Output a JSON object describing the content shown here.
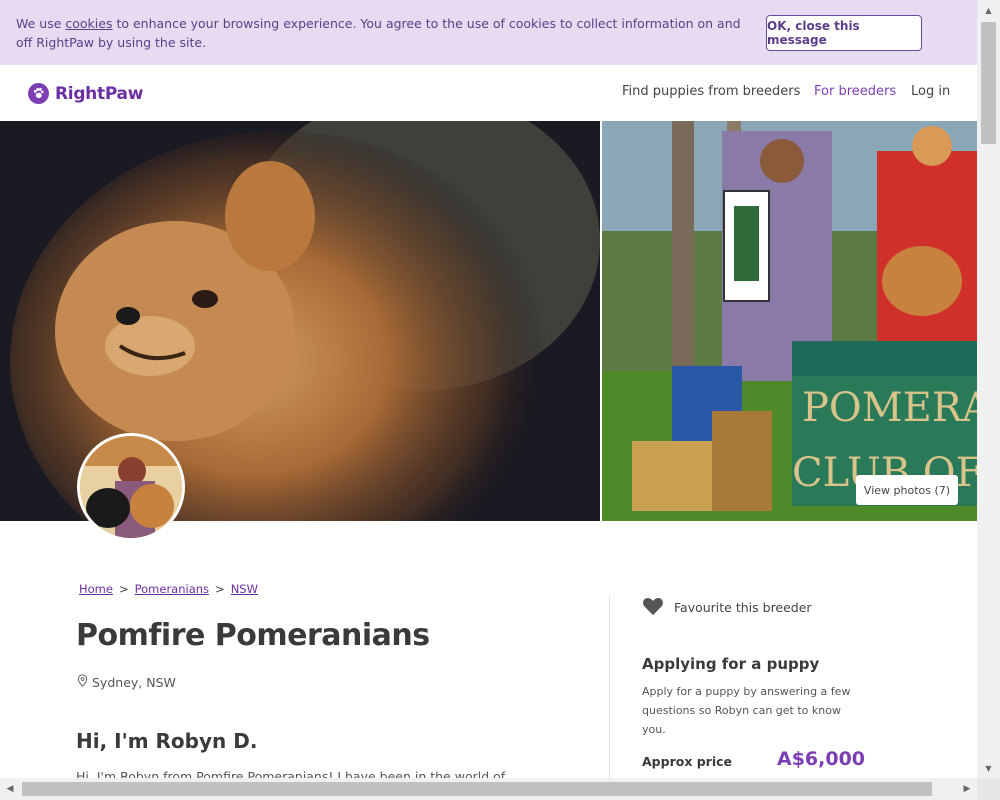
{
  "cookie_banner": {
    "text_before": "We use ",
    "link": "cookies",
    "text_after": " to enhance your browsing experience. You agree to the use of cookies to collect information on and off RightPaw by using the site.",
    "button": "OK, close this message",
    "bg_color": "#e6dbf0"
  },
  "header": {
    "logo": "RightPaw",
    "logo_icon": "paw-icon",
    "nav": {
      "find": "Find puppies from breeders",
      "breeders": "For breeders",
      "login": "Log in"
    },
    "brand_color": "#7b3fb3"
  },
  "hero": {
    "view_photos": "View photos (7)"
  },
  "breadcrumb": {
    "items": [
      "Home",
      "Pomeranians",
      "NSW"
    ],
    "separator": ">"
  },
  "breeder": {
    "name": "Pomfire Pomeranians",
    "location": "Sydney, NSW",
    "greeting": "Hi, I'm Robyn D.",
    "bio": "Hi, I'm Robyn from Pomfire Pomeranians! I have been in the world of"
  },
  "sidebar": {
    "favourite": "Favourite this breeder",
    "apply_title": "Applying for a puppy",
    "apply_desc": "Apply for a puppy by answering a few questions so Robyn can get to know you.",
    "price_label": "Approx price",
    "price_value": "A$6,000"
  }
}
